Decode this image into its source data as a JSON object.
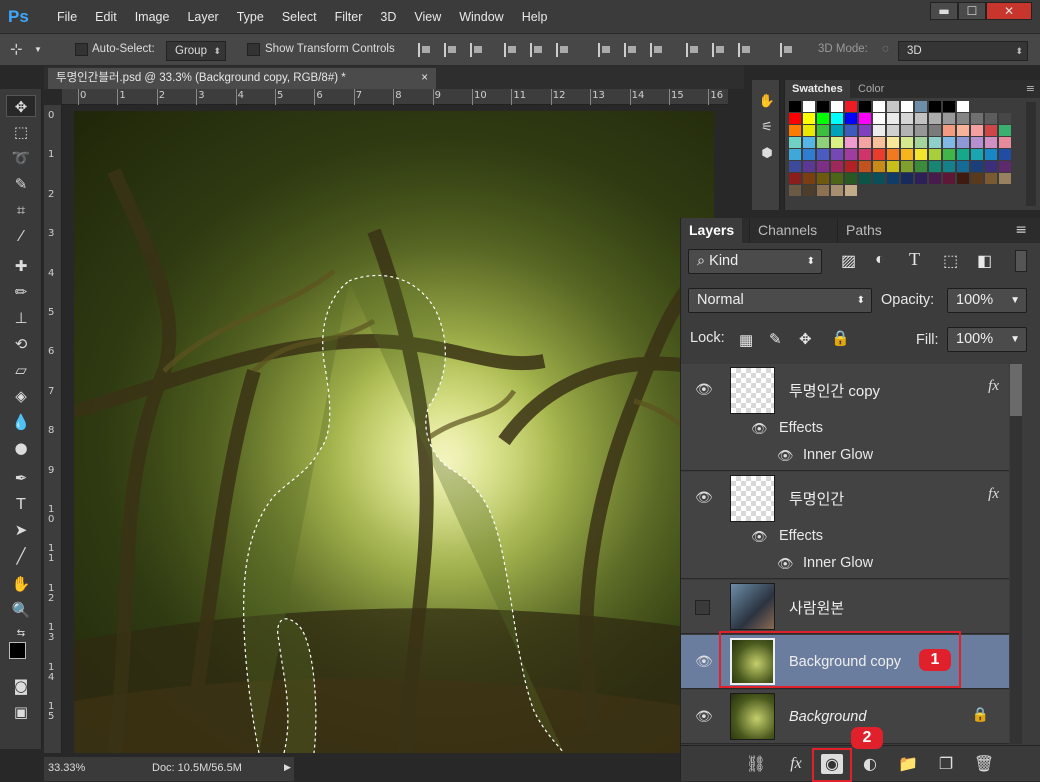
{
  "app": {
    "logo": "Ps",
    "menu": [
      "File",
      "Edit",
      "Image",
      "Layer",
      "Type",
      "Select",
      "Filter",
      "3D",
      "View",
      "Window",
      "Help"
    ]
  },
  "window_controls": {
    "minimize": "▬",
    "maximize": "☐",
    "close": "✕"
  },
  "options_bar": {
    "auto_select_label": "Auto-Select:",
    "auto_select_value": "Group",
    "transform_controls_label": "Show Transform Controls",
    "mode_3d_label": "3D Mode:",
    "mode_3d_value": "3D"
  },
  "document": {
    "tab_title": "투명인간블러.psd @ 33.3% (Background copy, RGB/8#) *",
    "close": "×",
    "ruler_top": [
      "0",
      "1",
      "2",
      "3",
      "4",
      "5",
      "6",
      "7",
      "8",
      "9",
      "10",
      "11",
      "12",
      "13",
      "14",
      "15",
      "16"
    ],
    "ruler_left": [
      "0",
      "1",
      "2",
      "3",
      "4",
      "5",
      "6",
      "7",
      "8",
      "9",
      "1\n0",
      "1\n1",
      "1\n2",
      "1\n3",
      "1\n4",
      "1\n5"
    ]
  },
  "status": {
    "zoom": "33.33%",
    "doc": "Doc: 10.5M/56.5M"
  },
  "swatches_panel": {
    "tabs": [
      "Swatches",
      "Color"
    ],
    "active": "Swatches"
  },
  "swatch_colors": [
    [
      "#000000",
      "#ffffff",
      "#000000",
      "#ffffff",
      "#ed1c24",
      "#000000",
      "#ffffff",
      "#c7c7c7",
      "#ffffff",
      "#6d8ea8",
      "#000000",
      "#000000",
      "#ffffff"
    ],
    [
      "#ff0000",
      "#ffff00",
      "#00ff00",
      "#00ffff",
      "#0000ff",
      "#ff00ff",
      "#ffffff",
      "#ebebeb",
      "#d6d6d6",
      "#c2c2c2",
      "#adadad",
      "#999999",
      "#858585",
      "#707070",
      "#5c5c5c",
      "#474747"
    ],
    [
      "#ff7b00",
      "#e8e800",
      "#3cbf3c",
      "#00a2b8",
      "#3d5bbf",
      "#7f3fbf",
      "#ececec",
      "#d0d0d0",
      "#b3b3b3",
      "#969696",
      "#7a7a7a",
      "#f29b7f",
      "#f7b39a",
      "#f4a0a0",
      "#cf4646",
      "#3ab06f"
    ],
    [
      "#6ed3c5",
      "#56b7e6",
      "#8fd07b",
      "#d8f084",
      "#ef9bd0",
      "#f5a3a3",
      "#f8c09a",
      "#f9e79a",
      "#d6e98f",
      "#a4d49b",
      "#8ecfc9",
      "#82b8e6",
      "#8e98d6",
      "#b590d0",
      "#d28fc4",
      "#e68b9c"
    ],
    [
      "#3ea8d8",
      "#2e7dd1",
      "#4a5cc2",
      "#7548b5",
      "#a03c9f",
      "#cf356a",
      "#ea3b2d",
      "#f07a1f",
      "#f7b41b",
      "#f3e52b",
      "#a7cf3a",
      "#41b54a",
      "#16a88b",
      "#1aa6b0",
      "#1887c6",
      "#204ca3"
    ],
    [
      "#3c4a9c",
      "#5b3894",
      "#7d2f86",
      "#9e285a",
      "#b22225",
      "#c2521e",
      "#c98a17",
      "#c8bf1b",
      "#7fa02c",
      "#3a8b3c",
      "#168573",
      "#13808a",
      "#156b98",
      "#1b3f7b",
      "#3b2f7c",
      "#5e2a6e"
    ],
    [
      "#8b1d1d",
      "#7a3e12",
      "#6e5a0f",
      "#4e6416",
      "#285824",
      "#0e5446",
      "#0c4f5a",
      "#0f3d67",
      "#162a5c",
      "#2d1f58",
      "#471c4c",
      "#5c1836",
      "#3e1a10",
      "#5a3a1c",
      "#7a5a33",
      "#988160"
    ],
    [
      "#6b5a43",
      "#4d3e2b",
      "#8c7153",
      "#a68e6e",
      "#c3aa88"
    ]
  ],
  "layers_panel": {
    "tabs": [
      "Layers",
      "Channels",
      "Paths"
    ],
    "active": "Layers",
    "kind": "Kind",
    "blend_mode": "Normal",
    "opacity_label": "Opacity:",
    "opacity_value": "100%",
    "lock_label": "Lock:",
    "fill_label": "Fill:",
    "fill_value": "100%",
    "layers": [
      {
        "name": "투명인간 copy",
        "fx": "fx",
        "effects_label": "Effects",
        "effect": "Inner Glow",
        "visible": true
      },
      {
        "name": "투명인간",
        "fx": "fx",
        "effects_label": "Effects",
        "effect": "Inner Glow",
        "visible": true
      },
      {
        "name": "사람원본",
        "visible": false
      },
      {
        "name": "Background copy",
        "visible": true,
        "selected": true
      },
      {
        "name": "Background",
        "visible": true,
        "locked": true
      }
    ],
    "badge1": "1",
    "badge2": "2"
  }
}
